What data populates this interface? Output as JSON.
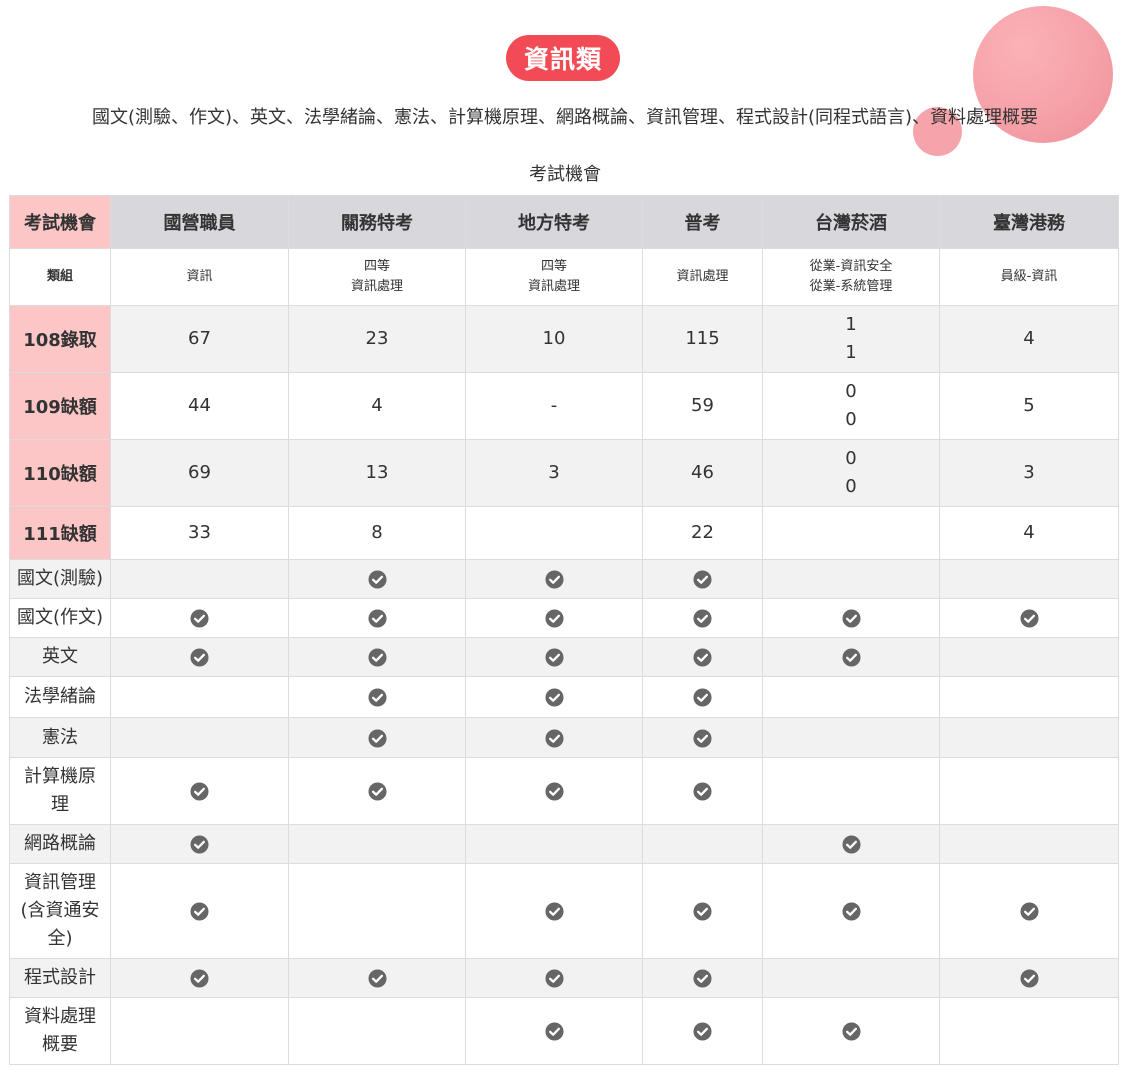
{
  "header": {
    "badge": "資訊類",
    "subjects": "國文(測驗、作文)、英文、法學緒論、憲法、計算機原理、網路概論、資訊管理、程式設計(同程式語言)、資料處理概要",
    "caption": "考試機會"
  },
  "colors": {
    "badge": "#f24b55",
    "label_pink": "#fcc6c6",
    "header_gray": "#d8d8dc",
    "row_alt": "#f2f2f2",
    "check": "#666666"
  },
  "table": {
    "corner": "考試機會",
    "columns": [
      "國營職員",
      "關務特考",
      "地方特考",
      "普考",
      "台灣菸酒",
      "臺灣港務"
    ],
    "class_row": {
      "label": "類組",
      "cells": [
        [
          "資訊"
        ],
        [
          "四等",
          "資訊處理"
        ],
        [
          "四等",
          "資訊處理"
        ],
        [
          "資訊處理"
        ],
        [
          "從業-資訊安全",
          "從業-系統管理"
        ],
        [
          "員級-資訊"
        ]
      ]
    },
    "stat_rows": [
      {
        "label": "108錄取",
        "cells": [
          [
            "67"
          ],
          [
            "23"
          ],
          [
            "10"
          ],
          [
            "115"
          ],
          [
            "1",
            "1"
          ],
          [
            "4"
          ]
        ]
      },
      {
        "label": "109缺額",
        "cells": [
          [
            "44"
          ],
          [
            "4"
          ],
          [
            "-"
          ],
          [
            "59"
          ],
          [
            "0",
            "0"
          ],
          [
            "5"
          ]
        ]
      },
      {
        "label": "110缺額",
        "cells": [
          [
            "69"
          ],
          [
            "13"
          ],
          [
            "3"
          ],
          [
            "46"
          ],
          [
            "0",
            "0"
          ],
          [
            "3"
          ]
        ]
      },
      {
        "label": "111缺額",
        "cells": [
          [
            "33"
          ],
          [
            "8"
          ],
          [],
          [
            "22"
          ],
          [],
          [
            "4"
          ]
        ]
      }
    ],
    "subject_rows": [
      {
        "label": [
          "國文(測驗)"
        ],
        "checks": [
          false,
          true,
          true,
          true,
          false,
          false
        ]
      },
      {
        "label": [
          "國文(作文)"
        ],
        "checks": [
          true,
          true,
          true,
          true,
          true,
          true
        ]
      },
      {
        "label": [
          "英文"
        ],
        "checks": [
          true,
          true,
          true,
          true,
          true,
          false
        ]
      },
      {
        "label": [
          "法學緒論"
        ],
        "checks": [
          false,
          true,
          true,
          true,
          false,
          false
        ]
      },
      {
        "label": [
          "憲法"
        ],
        "checks": [
          false,
          true,
          true,
          true,
          false,
          false
        ]
      },
      {
        "label": [
          "計算機原",
          "理"
        ],
        "checks": [
          true,
          true,
          true,
          true,
          false,
          false
        ]
      },
      {
        "label": [
          "網路概論"
        ],
        "checks": [
          true,
          false,
          false,
          false,
          true,
          false
        ]
      },
      {
        "label": [
          "資訊管理",
          "(含資通安",
          "全)"
        ],
        "checks": [
          true,
          false,
          true,
          true,
          true,
          true
        ]
      },
      {
        "label": [
          "程式設計"
        ],
        "checks": [
          true,
          true,
          true,
          true,
          false,
          true
        ]
      },
      {
        "label": [
          "資料處理",
          "概要"
        ],
        "checks": [
          false,
          false,
          true,
          true,
          true,
          false
        ]
      }
    ],
    "check_icon": "check-circle-icon"
  }
}
